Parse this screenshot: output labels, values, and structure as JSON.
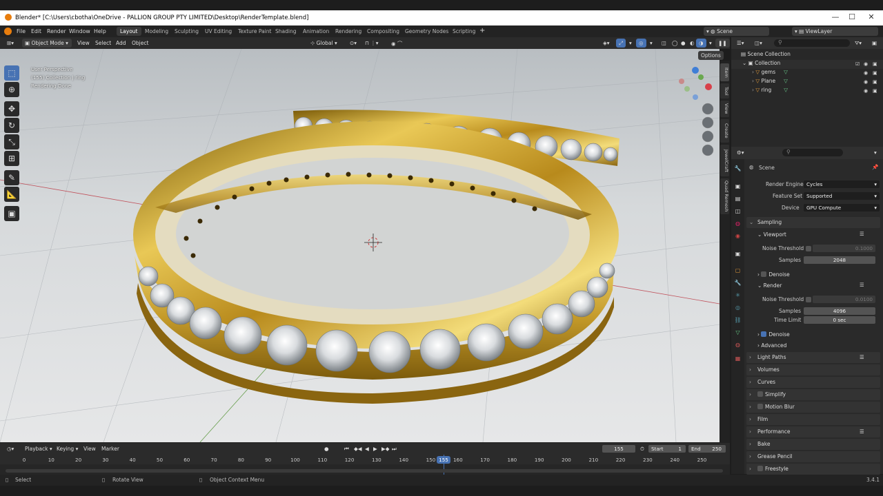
{
  "title": "Blender* [C:\\Users\\cbotha\\OneDrive - PALLION GROUP PTY LIMITED\\Desktop\\RenderTemplate.blend]",
  "menu": [
    "File",
    "Edit",
    "Render",
    "Window",
    "Help"
  ],
  "workspaces": [
    "Layout",
    "Modeling",
    "Sculpting",
    "UV Editing",
    "Texture Paint",
    "Shading",
    "Animation",
    "Rendering",
    "Compositing",
    "Geometry Nodes",
    "Scripting"
  ],
  "scene": "Scene",
  "viewlayer": "ViewLayer",
  "viewport_header": {
    "mode": "Object Mode",
    "view": "View",
    "select": "Select",
    "add": "Add",
    "object": "Object",
    "orientation": "Global",
    "options": "Options"
  },
  "viewport_info": {
    "line1": "User Perspective",
    "line2": "(155) Collection | ring",
    "line3": "Rendering Done"
  },
  "side_tabs": [
    "Item",
    "Tool",
    "View",
    "Create",
    "JewelCraft",
    "Quad Remesh"
  ],
  "outliner": {
    "root": "Scene Collection",
    "collection": "Collection",
    "items": [
      "gems",
      "Plane",
      "ring"
    ]
  },
  "properties": {
    "context": "Scene",
    "render_engine_label": "Render Engine",
    "render_engine": "Cycles",
    "feature_set_label": "Feature Set",
    "feature_set": "Supported",
    "device_label": "Device",
    "device": "GPU Compute",
    "sampling": "Sampling",
    "viewport": "Viewport",
    "noise_threshold_label": "Noise Threshold",
    "vp_noise": "0.1000",
    "samples_label": "Samples",
    "vp_samples": "2048",
    "denoise": "Denoise",
    "render": "Render",
    "r_noise": "0.0100",
    "r_samples": "4096",
    "time_limit_label": "Time Limit",
    "time_limit": "0 sec",
    "advanced": "Advanced",
    "sections": [
      "Light Paths",
      "Volumes",
      "Curves",
      "Simplify",
      "Motion Blur",
      "Film",
      "Performance",
      "Bake",
      "Grease Pencil",
      "Freestyle"
    ]
  },
  "timeline": {
    "playback": "Playback",
    "keying": "Keying",
    "view": "View",
    "marker": "Marker",
    "current": "155",
    "start_label": "Start",
    "start": "1",
    "end_label": "End",
    "end": "250",
    "ticks": [
      "0",
      "10",
      "20",
      "30",
      "40",
      "50",
      "60",
      "70",
      "80",
      "90",
      "100",
      "110",
      "120",
      "130",
      "140",
      "150",
      "160",
      "170",
      "180",
      "190",
      "200",
      "210",
      "220",
      "230",
      "240",
      "250"
    ]
  },
  "status": {
    "select": "Select",
    "rotate": "Rotate View",
    "context": "Object Context Menu",
    "version": "3.4.1"
  }
}
